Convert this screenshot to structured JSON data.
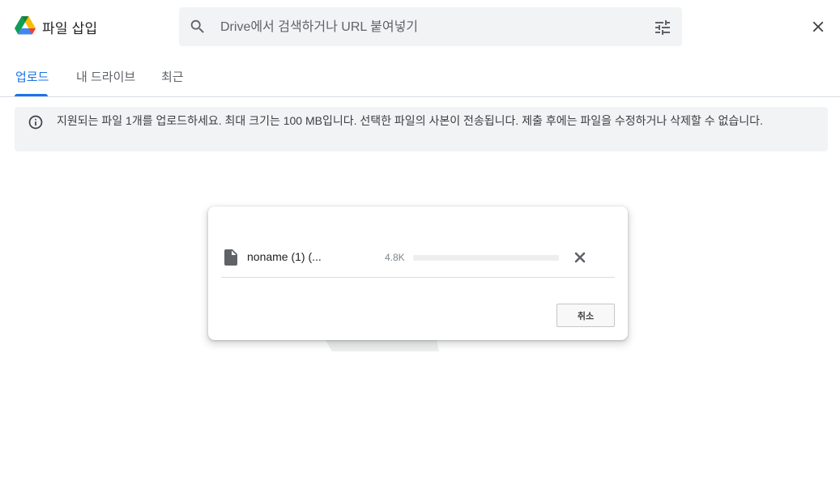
{
  "header": {
    "title": "파일 삽입",
    "search_placeholder": "Drive에서 검색하거나 URL 붙여넣기"
  },
  "tabs": [
    {
      "label": "업로드",
      "active": true
    },
    {
      "label": "내 드라이브",
      "active": false
    },
    {
      "label": "최근",
      "active": false
    }
  ],
  "info": {
    "text": "지원되는 파일 1개를 업로드하세요. 최대 크기는 100 MB입니다. 선택한 파일의 사본이 전송됩니다. 제출 후에는 파일을 수정하거나 삭제할 수 없습니다."
  },
  "upload": {
    "file_name": "noname (1) (...",
    "file_size": "4.8K",
    "progress": 0,
    "cancel_label": "취소"
  },
  "colors": {
    "accent": "#1a73e8",
    "banner_bg": "#f1f3f4",
    "search_bg": "#f1f3f4"
  },
  "icons": {
    "logo": "google-drive-logo",
    "search": "search-icon",
    "filter": "tune-icon",
    "close": "close-icon",
    "info": "info-icon",
    "file": "file-icon",
    "file_cancel": "close-x-icon"
  }
}
